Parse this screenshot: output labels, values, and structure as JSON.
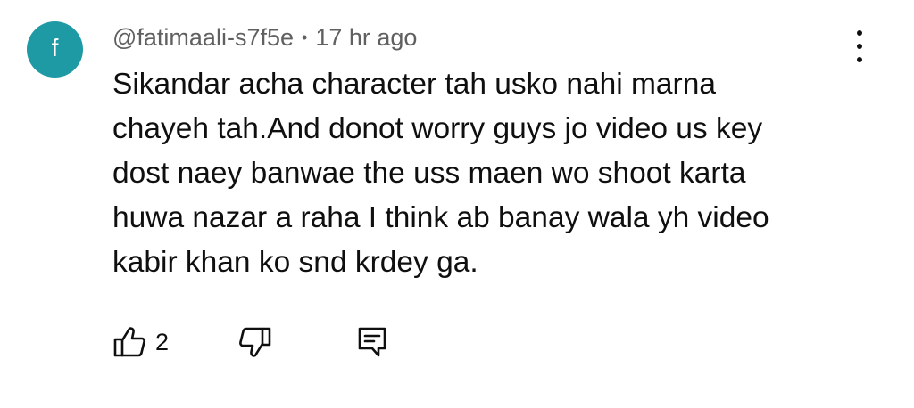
{
  "comment": {
    "avatar_letter": "f",
    "avatar_color": "#1e9aa5",
    "author": "@fatimaali-s7f5e",
    "separator": "•",
    "time": "17 hr ago",
    "text_lines": [
      "Sikandar acha character tah usko nahi marna",
      "chayeh tah.And donot worry guys jo video us key",
      "dost naey banwae the uss maen wo shoot karta",
      "huwa nazar a raha I think ab banay wala yh video",
      "kabir khan ko snd krdey ga."
    ],
    "like_count": "2"
  },
  "icons": {
    "more": "more-vertical-icon",
    "like": "thumbs-up-icon",
    "dislike": "thumbs-down-icon",
    "reply": "reply-comment-icon"
  },
  "colors": {
    "text": "#0f0f0f",
    "meta": "#606060"
  }
}
